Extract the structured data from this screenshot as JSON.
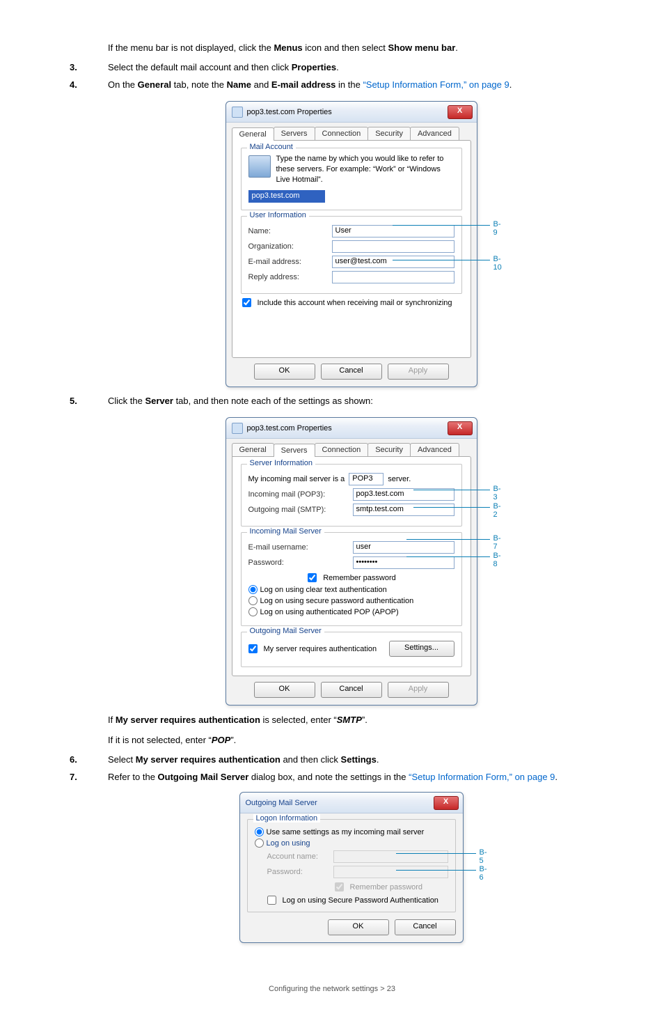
{
  "intro": {
    "menu_line_a": "If the menu bar is not displayed, click the ",
    "menu_bold1": "Menus",
    "menu_line_b": " icon and then select ",
    "menu_bold2": "Show menu bar",
    "period": "."
  },
  "step3": {
    "num": "3.",
    "a": "Select the default mail account and then click ",
    "b": "Properties",
    "c": "."
  },
  "step4": {
    "num": "4.",
    "a": "On the ",
    "b": "General",
    "c": " tab, note the ",
    "d": "Name",
    "e": " and ",
    "f": "E-mail address",
    "g": " in the ",
    "link": "“Setup Information Form,” on page 9",
    "h": "."
  },
  "dlg1": {
    "title": "pop3.test.com Properties",
    "tabs": [
      "General",
      "Servers",
      "Connection",
      "Security",
      "Advanced"
    ],
    "group_mail": "Mail Account",
    "desc": "Type the name by which you would like to refer to these servers. For example: “Work” or “Windows Live Hotmail”.",
    "account_val": "pop3.test.com",
    "group_user": "User Information",
    "name_lbl": "Name:",
    "name_val": "User",
    "org_lbl": "Organization:",
    "email_lbl": "E-mail address:",
    "email_val": "user@test.com",
    "reply_lbl": "Reply address:",
    "include_chk": "Include this account when receiving mail or synchronizing",
    "ok": "OK",
    "cancel": "Cancel",
    "apply": "Apply",
    "c1": "B-9",
    "c2": "B-10"
  },
  "step5": {
    "num": "5.",
    "a": "Click the ",
    "b": "Server",
    "c": " tab, and then note each of the settings as shown:"
  },
  "dlg2": {
    "title": "pop3.test.com Properties",
    "tabs": [
      "General",
      "Servers",
      "Connection",
      "Security",
      "Advanced"
    ],
    "group_si": "Server Information",
    "si_a": "My incoming mail server is a",
    "si_pop3": "POP3",
    "si_b": "server.",
    "in_lbl": "Incoming mail (POP3):",
    "in_val": "pop3.test.com",
    "out_lbl": "Outgoing mail (SMTP):",
    "out_val": "smtp.test.com",
    "group_ims": "Incoming Mail Server",
    "user_lbl": "E-mail username:",
    "user_val": "user",
    "pass_lbl": "Password:",
    "pass_val": "••••••••",
    "remember": "Remember password",
    "r1": "Log on using clear text authentication",
    "r2": "Log on using secure password authentication",
    "r3": "Log on using authenticated POP (APOP)",
    "group_oms": "Outgoing Mail Server",
    "auth_chk": "My server requires authentication",
    "settings_btn": "Settings...",
    "ok": "OK",
    "cancel": "Cancel",
    "apply": "Apply",
    "c1": "B-3",
    "c2": "B-2",
    "c3": "B-7",
    "c4": "B-8"
  },
  "after2": {
    "a": "If ",
    "b": "My server requires authentication",
    "c": " is selected, enter “",
    "d": "SMTP",
    "e": "”.",
    "f": "If it is not selected, enter “",
    "g": "POP",
    "h": "”."
  },
  "step6": {
    "num": "6.",
    "a": "Select ",
    "b": "My server requires authentication",
    "c": " and then click ",
    "d": "Settings",
    "e": "."
  },
  "step7": {
    "num": "7.",
    "a": "Refer to the ",
    "b": "Outgoing Mail Server",
    "c": " dialog box, and note the settings in the ",
    "link": "“Setup Information Form,” on page 9",
    "d": "."
  },
  "dlg3": {
    "title": "Outgoing Mail Server",
    "group": "Logon Information",
    "r1": "Use same settings as my incoming mail server",
    "r2": "Log on using",
    "acct_lbl": "Account name:",
    "pass_lbl": "Password:",
    "remember": "Remember password",
    "spa": "Log on using Secure Password Authentication",
    "ok": "OK",
    "cancel": "Cancel",
    "c1": "B-5",
    "c2": "B-6"
  },
  "footer": "Configuring the network settings > 23",
  "close_x": "X"
}
